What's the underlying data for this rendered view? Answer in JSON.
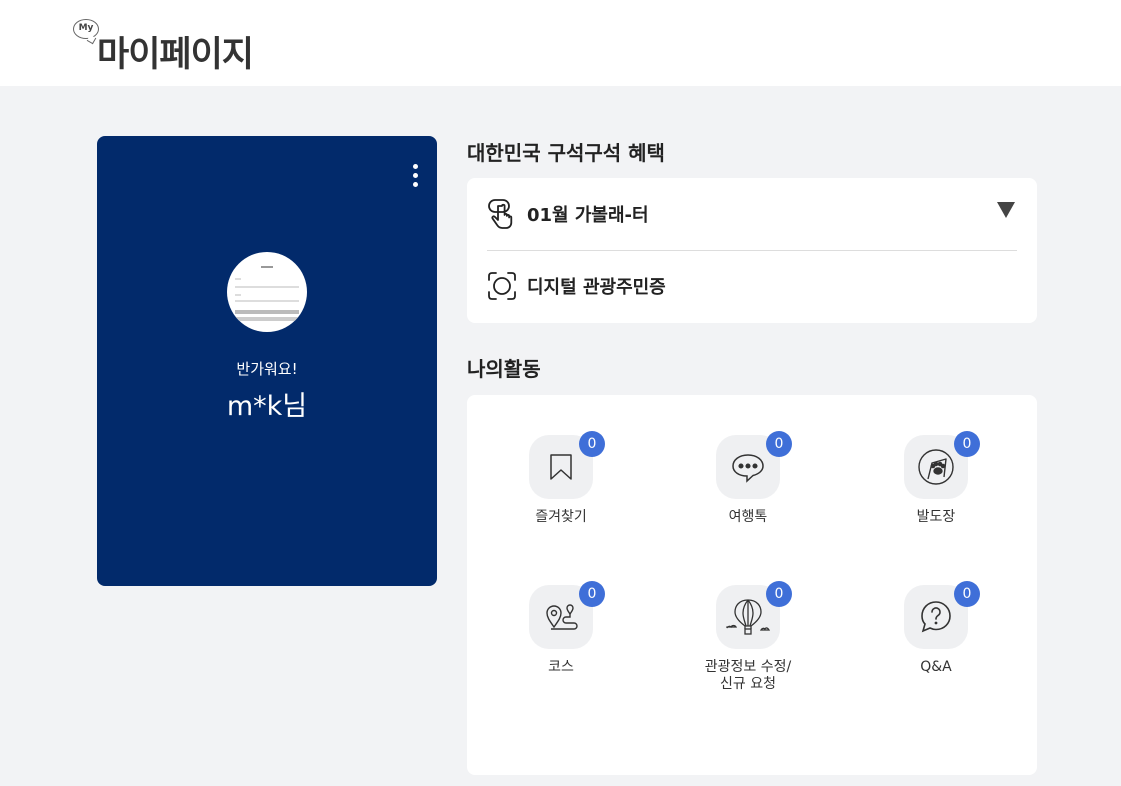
{
  "header": {
    "badge": "My",
    "title": "마이페이지"
  },
  "profile": {
    "greeting": "반가워요!",
    "name": "m*k님"
  },
  "benefits": {
    "title": "대한민국 구석구석 혜택",
    "items": [
      {
        "label": "01월 가볼래-터",
        "icon": "tap-hand-icon"
      },
      {
        "label": "디지털 관광주민증",
        "icon": "face-scan-icon"
      }
    ]
  },
  "activity": {
    "title": "나의활동",
    "items": [
      {
        "label": "즐겨찾기",
        "count": "0",
        "icon": "bookmark-icon"
      },
      {
        "label": "여행톡",
        "count": "0",
        "icon": "chat-bubble-icon"
      },
      {
        "label": "발도장",
        "count": "0",
        "icon": "paw-stamp-icon"
      },
      {
        "label": "코스",
        "count": "0",
        "icon": "route-pin-icon"
      },
      {
        "label": "관광정보 수정/\n신규 요청",
        "count": "0",
        "icon": "hot-air-balloon-icon"
      },
      {
        "label": "Q&A",
        "count": "0",
        "icon": "question-bubble-icon"
      }
    ]
  }
}
